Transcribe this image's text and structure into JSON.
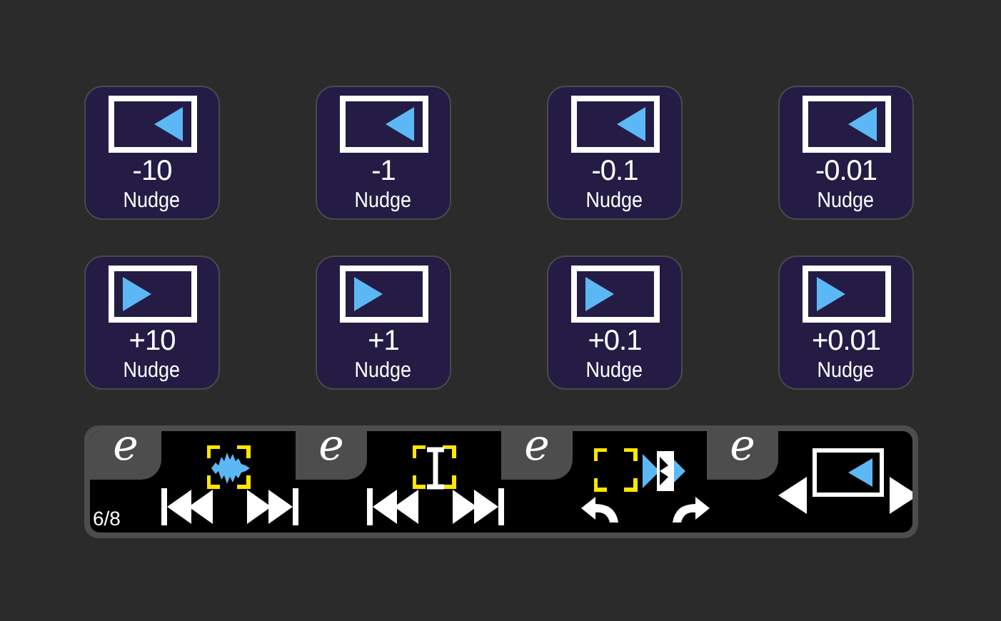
{
  "nudge_buttons": [
    {
      "value": "-10",
      "label": "Nudge",
      "kind": "left"
    },
    {
      "value": "-1",
      "label": "Nudge",
      "kind": "left"
    },
    {
      "value": "-0.1",
      "label": "Nudge",
      "kind": "left"
    },
    {
      "value": "-0.01",
      "label": "Nudge",
      "kind": "left"
    },
    {
      "value": "+10",
      "label": "Nudge",
      "kind": "right"
    },
    {
      "value": "+1",
      "label": "Nudge",
      "kind": "right"
    },
    {
      "value": "+0.1",
      "label": "Nudge",
      "kind": "right"
    },
    {
      "value": "+0.01",
      "label": "Nudge",
      "kind": "right"
    }
  ],
  "bottom_bar": {
    "page_indicator": "6/8",
    "segments": [
      {
        "tab": "e",
        "kind": "waveform-skip"
      },
      {
        "tab": "e",
        "kind": "cursor-skip"
      },
      {
        "tab": "e",
        "kind": "region-undo"
      },
      {
        "tab": "e",
        "kind": "nudge-step"
      }
    ]
  }
}
